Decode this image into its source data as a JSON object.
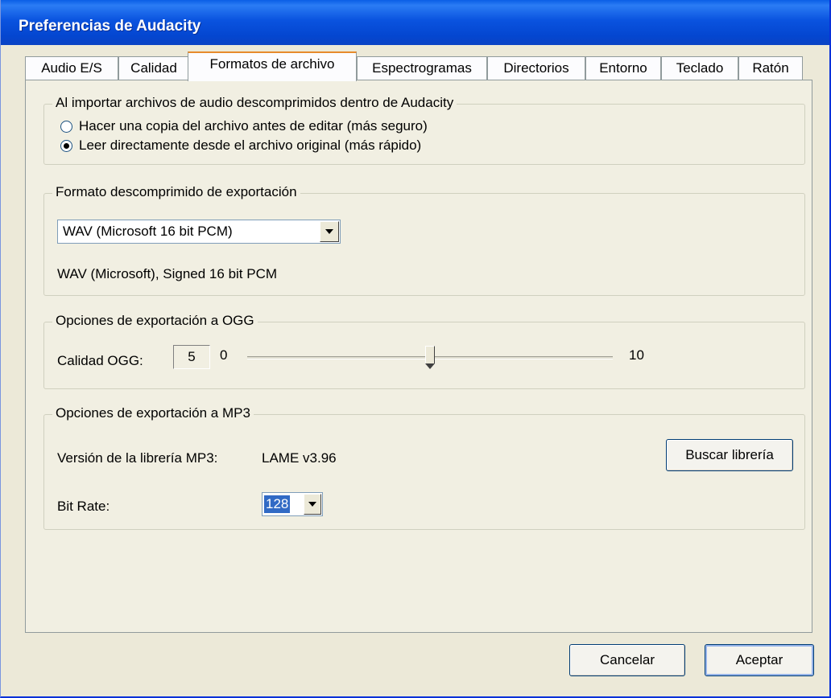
{
  "window": {
    "title": "Preferencias de Audacity"
  },
  "tabs": [
    {
      "label": "Audio E/S"
    },
    {
      "label": "Calidad"
    },
    {
      "label": "Formatos de archivo",
      "active": true
    },
    {
      "label": "Espectrogramas"
    },
    {
      "label": "Directorios"
    },
    {
      "label": "Entorno"
    },
    {
      "label": "Teclado"
    },
    {
      "label": "Ratón"
    }
  ],
  "import_group": {
    "title": "Al importar archivos de audio descomprimidos dentro de Audacity",
    "option_copy": "Hacer una copia del archivo antes de editar (más seguro)",
    "option_direct": "Leer directamente desde el archivo original (más rápido)",
    "selected": "direct"
  },
  "export_format_group": {
    "title": "Formato descomprimido de exportación",
    "selected_format": "WAV (Microsoft 16 bit PCM)",
    "description": "WAV (Microsoft), Signed 16 bit PCM"
  },
  "ogg_group": {
    "title": "Opciones de exportación a OGG",
    "quality_label": "Calidad OGG:",
    "quality_value": "5",
    "min_label": "0",
    "max_label": "10",
    "slider_fraction": 0.5
  },
  "mp3_group": {
    "title": "Opciones de exportación a MP3",
    "library_label": "Versión de la librería MP3:",
    "library_version": "LAME v3.96",
    "find_library_button": "Buscar librería",
    "bitrate_label": "Bit Rate:",
    "bitrate_value": "128"
  },
  "buttons": {
    "cancel": "Cancelar",
    "ok": "Aceptar"
  }
}
